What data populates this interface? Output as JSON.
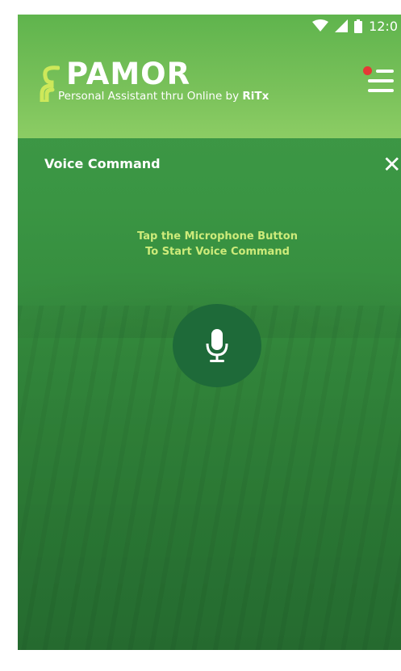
{
  "status_bar": {
    "time": "12:0",
    "icons": [
      "wifi-icon",
      "signal-icon",
      "battery-icon"
    ]
  },
  "header": {
    "logo_word": "PAMOR",
    "tagline": "Personal Assistant thru Online by ",
    "tagline_brand": "RiTx",
    "menu_icon": "hamburger-menu-icon",
    "notification_dot_color": "#e53935"
  },
  "voice_panel": {
    "title": "Voice Command",
    "close_icon": "close-icon",
    "instruction_line1": "Tap the Microphone Button",
    "instruction_line2": "To Start Voice Command",
    "mic_icon": "microphone-icon"
  },
  "colors": {
    "header_green": "#79c15a",
    "body_green": "#3a9543",
    "mic_button": "#1e6a39",
    "instruction_text": "#cdeb7a"
  }
}
